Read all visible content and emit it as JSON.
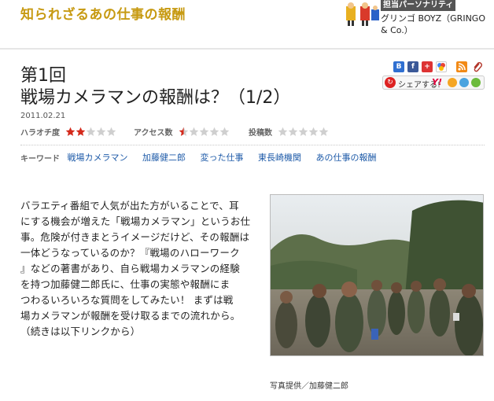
{
  "header": {
    "series_title": "知られざるあの仕事の報酬",
    "role_badge": "担当パーソナリティ",
    "personality_name": "グリンゴ BOYZ（GRINGO & Co.）"
  },
  "article": {
    "episode_number": "第1回",
    "title": "戦場カメラマンの報酬は？（1/2）",
    "date": "2011.02.21",
    "ratings": [
      {
        "label": "ハラオチ度",
        "filled": 2,
        "half": 0,
        "total": 5
      },
      {
        "label": "アクセス数",
        "filled": 0,
        "half": 1,
        "total": 5
      },
      {
        "label": "投稿数",
        "filled": 0,
        "half": 0,
        "total": 5
      }
    ],
    "keywords_label": "キーワード",
    "keywords": [
      "戦場カメラマン",
      "加藤健二郎",
      "変った仕事",
      "東長崎機関",
      "あの仕事の報酬"
    ],
    "body_lines": [
      "バラエティ番組で人気が出た方がいることで、耳",
      "にする機会が増えた「戦場カメラマン」というお仕",
      "事。危険が付きまとうイメージだけど、その報酬は",
      "一体どうなっているのか？『戦場のハローワーク",
      "』などの著書があり、自ら戦場カメラマンの経験",
      "を持つ加藤健二郎氏に、仕事の実態や報酬にま",
      "つわるいろいろな質問をしてみたい！ まずは戦",
      "場カメラマンが報酬を受け取るまでの流れから。",
      "（続きは以下リンクから）"
    ],
    "photo_caption": "写真提供／加藤健二郎"
  },
  "share": {
    "label": "シェアする!",
    "yahoo_label": "Y!",
    "icons": [
      "B",
      "f",
      "s",
      "g",
      "rss",
      "clip"
    ]
  },
  "colors": {
    "series_gold": "#c79a12",
    "link_blue": "#1d5aa8",
    "star_red": "#d42a1c",
    "star_gray": "#cfcfcf"
  }
}
